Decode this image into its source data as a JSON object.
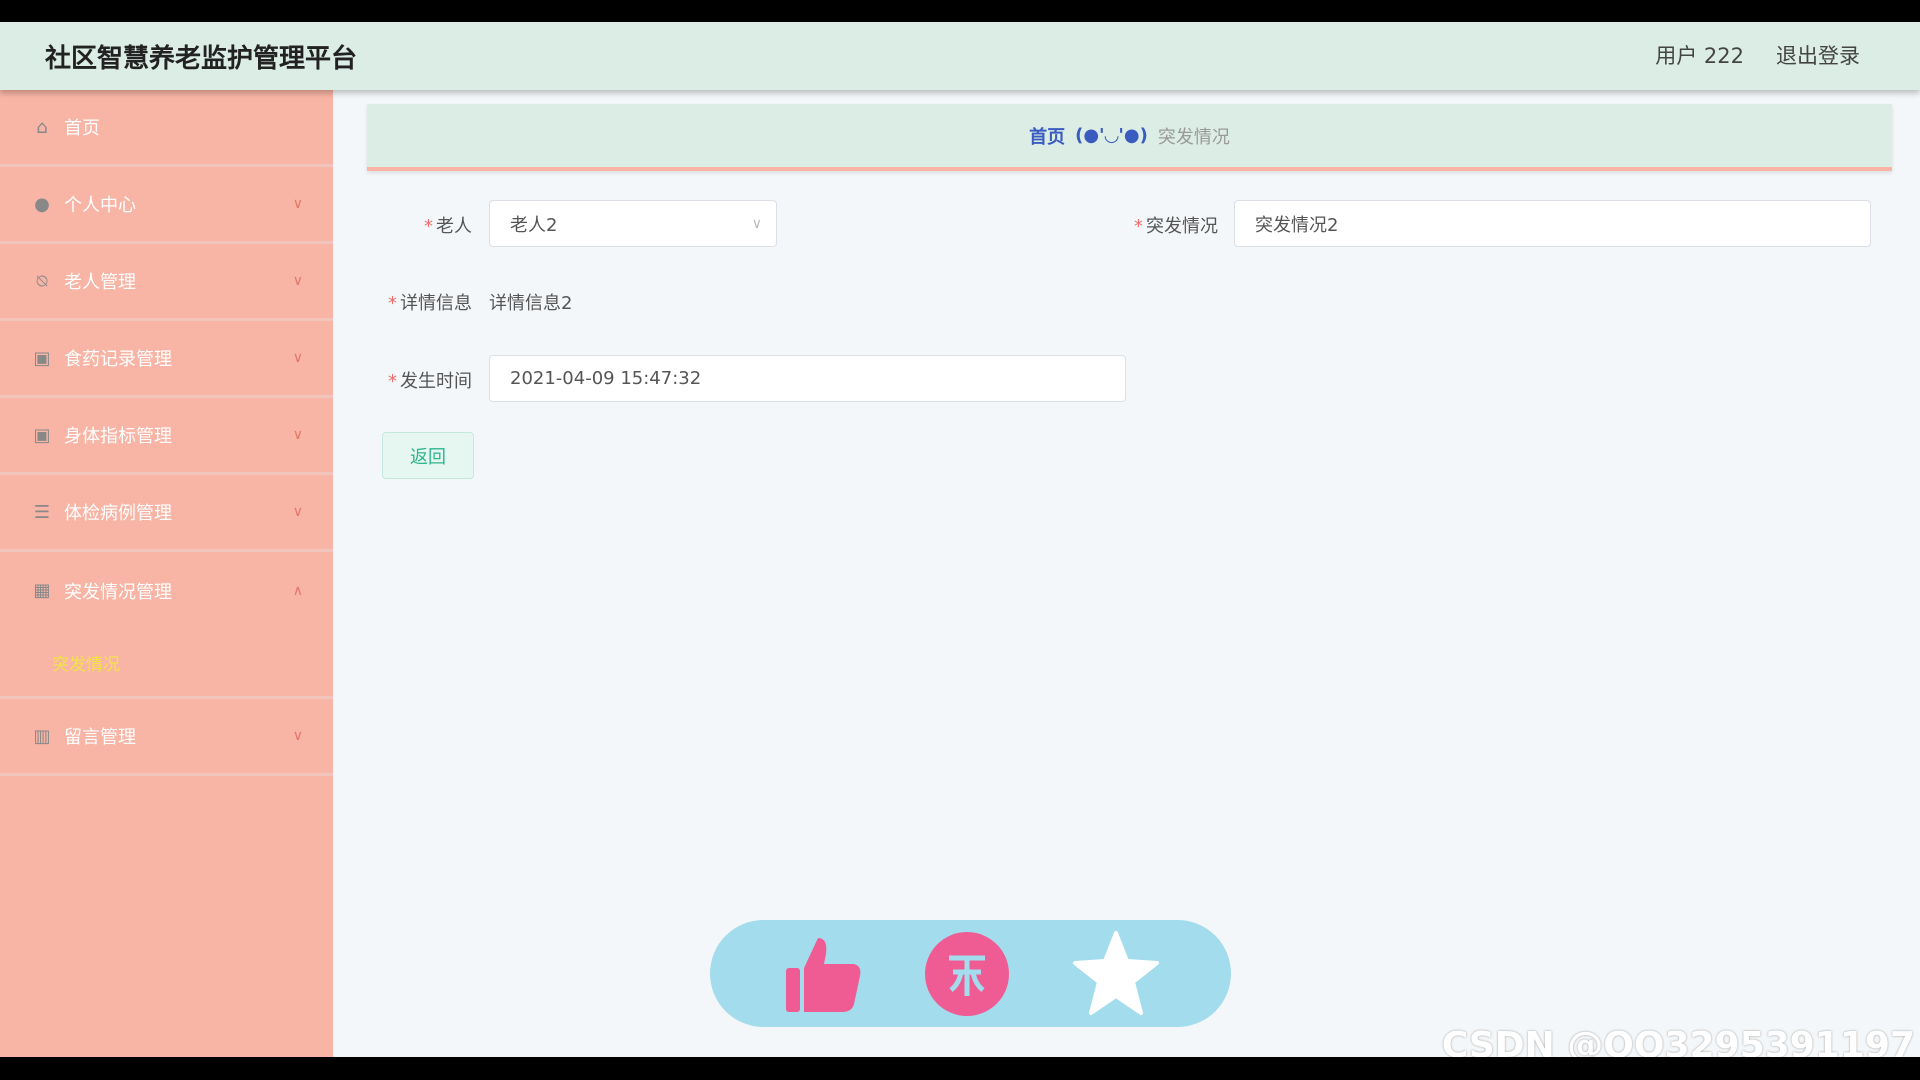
{
  "header": {
    "title": "社区智慧养老监护管理平台",
    "user": "用户 222",
    "logout": "退出登录"
  },
  "sidebar": {
    "items": [
      {
        "label": "首页",
        "icon": "home-icon"
      },
      {
        "label": "个人中心",
        "icon": "user-icon"
      },
      {
        "label": "老人管理",
        "icon": "bell-off-icon"
      },
      {
        "label": "食药记录管理",
        "icon": "clipboard-check-icon"
      },
      {
        "label": "身体指标管理",
        "icon": "clipboard-x-icon"
      },
      {
        "label": "体检病例管理",
        "icon": "menu-icon"
      },
      {
        "label": "突发情况管理",
        "icon": "grid-icon",
        "expanded": true,
        "children": [
          {
            "label": "突发情况",
            "active": true
          }
        ]
      },
      {
        "label": "留言管理",
        "icon": "books-icon"
      }
    ]
  },
  "breadcrumb": {
    "home": "首页",
    "sep": "(●'◡'●)",
    "current": "突发情况"
  },
  "form": {
    "elder_label": "老人",
    "elder_value": "老人2",
    "incident_label": "突发情况",
    "incident_value": "突发情况2",
    "detail_label": "详情信息",
    "detail_value": "详情信息2",
    "time_label": "发生时间",
    "time_value": "2021-04-09 15:47:32",
    "required": "*",
    "back": "返回"
  },
  "watermark": "CSDN @QQ3295391197",
  "colors": {
    "sidebar": "#f8b4a4",
    "header": "#dcede6",
    "accent": "#2fb58a",
    "float": "#a3dcec",
    "pink": "#ef5b93"
  }
}
